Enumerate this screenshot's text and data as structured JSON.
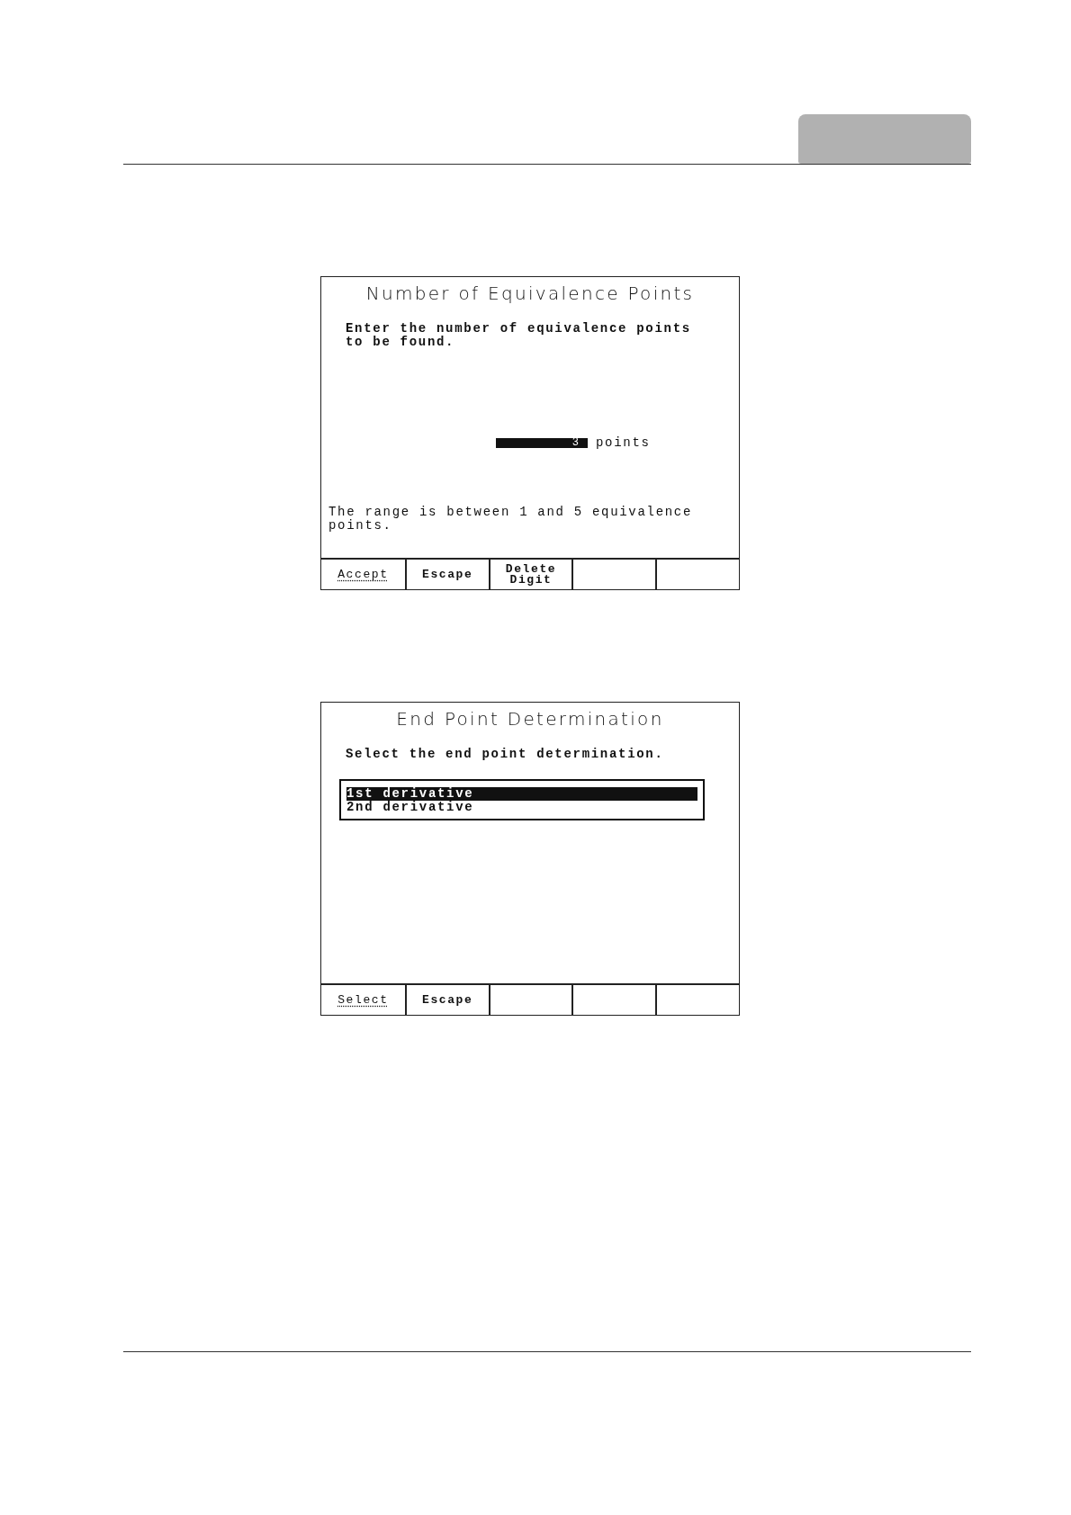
{
  "screens": [
    {
      "title": "Number of Equivalence Points",
      "kind": "entry",
      "prompt": "Enter the number of equivalence points to be found.",
      "field": {
        "value": "3",
        "unit": "points"
      },
      "note": "The range is between 1 and 5 equivalence points.",
      "softkeys": [
        {
          "label": "Accept",
          "default": true
        },
        {
          "label": "Escape",
          "default": false
        },
        {
          "label": "Delete Digit",
          "default": false
        }
      ]
    },
    {
      "title": "End Point Determination",
      "kind": "select",
      "prompt": "Select the end point determination.",
      "options": [
        {
          "label": "1st derivative",
          "selected": true
        },
        {
          "label": "2nd derivative",
          "selected": false
        }
      ],
      "softkeys": [
        {
          "label": "Select",
          "default": true
        },
        {
          "label": "Escape",
          "default": false
        }
      ]
    }
  ]
}
